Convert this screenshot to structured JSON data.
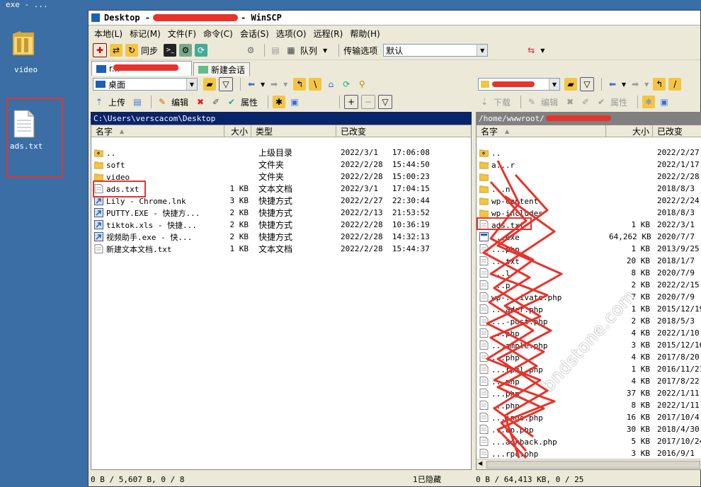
{
  "desktop": {
    "top_label": "exe - ...",
    "icons": [
      {
        "label": "video"
      },
      {
        "label": "ads.txt"
      }
    ]
  },
  "window": {
    "title_prefix": "Desktop - ",
    "title_suffix": " - WinSCP",
    "menu": [
      "本地(L)",
      "标记(M)",
      "文件(F)",
      "命令(C)",
      "会话(S)",
      "选项(O)",
      "远程(R)",
      "帮助(H)"
    ],
    "toolbar": {
      "sync_label": "同步",
      "queue_label": "队列",
      "transfer_options_label": "传输选项",
      "transfer_preset_value": "默认"
    },
    "tabs": [
      {
        "label": "r..."
      },
      {
        "label": "新建会话"
      }
    ]
  },
  "left": {
    "location": "桌面",
    "actions": {
      "upload": "上传",
      "edit": "编辑",
      "properties": "属性"
    },
    "path": "C:\\Users\\verscacom\\Desktop",
    "columns": {
      "name": "名字",
      "size": "大小",
      "type": "类型",
      "changed": "已改变"
    },
    "files": [
      {
        "name": "..",
        "size": "",
        "type": "上级目录",
        "changed": "2022/3/1   17:06:08",
        "icon": "parent-dir"
      },
      {
        "name": "soft",
        "size": "",
        "type": "文件夹",
        "changed": "2022/2/28  15:44:50",
        "icon": "folder"
      },
      {
        "name": "video",
        "size": "",
        "type": "文件夹",
        "changed": "2022/2/28  15:00:23",
        "icon": "folder"
      },
      {
        "name": "ads.txt",
        "size": "1 KB",
        "type": "文本文档",
        "changed": "2022/3/1   17:04:15",
        "icon": "text-file"
      },
      {
        "name": "Lily - Chrome.lnk",
        "size": "3 KB",
        "type": "快捷方式",
        "changed": "2022/2/27  22:30:44",
        "icon": "shortcut"
      },
      {
        "name": "PUTTY.EXE - 快捷方...",
        "size": "2 KB",
        "type": "快捷方式",
        "changed": "2022/2/13  21:53:52",
        "icon": "shortcut"
      },
      {
        "name": "tiktok.xls - 快捷...",
        "size": "2 KB",
        "type": "快捷方式",
        "changed": "2022/2/28  10:36:19",
        "icon": "shortcut"
      },
      {
        "name": "视频助手.exe - 快...",
        "size": "2 KB",
        "type": "快捷方式",
        "changed": "2022/2/28  14:32:13",
        "icon": "shortcut"
      },
      {
        "name": "新建文本文档.txt",
        "size": "1 KB",
        "type": "文本文档",
        "changed": "2022/2/28  15:44:37",
        "icon": "text-file"
      }
    ],
    "status": "0 B / 5,607 B,  0 / 8",
    "hidden": "1已隐藏"
  },
  "right": {
    "actions": {
      "download": "下载",
      "edit": "编辑",
      "properties": "属性"
    },
    "path": "/home/wwwroot/",
    "columns": {
      "name": "名字",
      "size": "大小",
      "changed": "已改变"
    },
    "files": [
      {
        "name": "..",
        "size": "",
        "changed": "2022/2/27",
        "icon": "parent-dir"
      },
      {
        "name": "a...r",
        "size": "",
        "changed": "2022/1/17",
        "icon": "folder"
      },
      {
        "name": "",
        "size": "",
        "changed": "2022/2/28",
        "icon": "folder"
      },
      {
        "name": "...n",
        "size": "",
        "changed": "2018/8/3",
        "icon": "folder"
      },
      {
        "name": "wp-content",
        "size": "",
        "changed": "2022/2/24",
        "icon": "folder"
      },
      {
        "name": "wp-includes",
        "size": "",
        "changed": "2018/8/3",
        "icon": "folder"
      },
      {
        "name": "ads.txt",
        "size": "1 KB",
        "changed": "2022/3/1",
        "icon": "text-file"
      },
      {
        "name": "...exe",
        "size": "64,262 KB",
        "changed": "2020/7/7",
        "icon": "exe"
      },
      {
        "name": "...php",
        "size": "1 KB",
        "changed": "2013/9/25",
        "icon": "text-file"
      },
      {
        "name": "...txt",
        "size": "20 KB",
        "changed": "2018/1/7",
        "icon": "text-file"
      },
      {
        "name": "...l",
        "size": "8 KB",
        "changed": "2020/7/9",
        "icon": "text-file"
      },
      {
        "name": "...p",
        "size": "2 KB",
        "changed": "2022/2/15",
        "icon": "text-file"
      },
      {
        "name": "wp-...ivate.php",
        "size": "7 KB",
        "changed": "2020/7/9",
        "icon": "text-file"
      },
      {
        "name": "...ader.php",
        "size": "1 KB",
        "changed": "2015/12/19",
        "icon": "text-file"
      },
      {
        "name": "...-post.php",
        "size": "2 KB",
        "changed": "2018/5/3",
        "icon": "text-file"
      },
      {
        "name": "...php",
        "size": "4 KB",
        "changed": "2022/1/10",
        "icon": "text-file"
      },
      {
        "name": "...ample.php",
        "size": "3 KB",
        "changed": "2015/12/16",
        "icon": "text-file"
      },
      {
        "name": "...php",
        "size": "4 KB",
        "changed": "2017/8/20",
        "icon": "text-file"
      },
      {
        "name": "...rpml.php",
        "size": "1 KB",
        "changed": "2016/11/21",
        "icon": "text-file"
      },
      {
        "name": "...php",
        "size": "4 KB",
        "changed": "2017/8/22",
        "icon": "text-file"
      },
      {
        "name": "...php",
        "size": "37 KB",
        "changed": "2022/1/11",
        "icon": "text-file"
      },
      {
        "name": "...php",
        "size": "8 KB",
        "changed": "2022/1/11",
        "icon": "text-file"
      },
      {
        "name": "...ings.php",
        "size": "16 KB",
        "changed": "2017/10/4",
        "icon": "text-file"
      },
      {
        "name": "...up.php",
        "size": "30 KB",
        "changed": "2018/4/30",
        "icon": "text-file"
      },
      {
        "name": "...ackback.php",
        "size": "5 KB",
        "changed": "2017/10/24",
        "icon": "text-file"
      },
      {
        "name": "...rpc.php",
        "size": "3 KB",
        "changed": "2016/9/1",
        "icon": "text-file"
      }
    ],
    "status": "0 B / 64,413 KB,  0 / 25"
  },
  "watermark": "bndstone.com",
  "colors": {
    "desktop": "#3a6ea5",
    "annotation_red": "#e8332a",
    "left_path_bg": "#0a246a",
    "right_path_bg": "#808080"
  }
}
